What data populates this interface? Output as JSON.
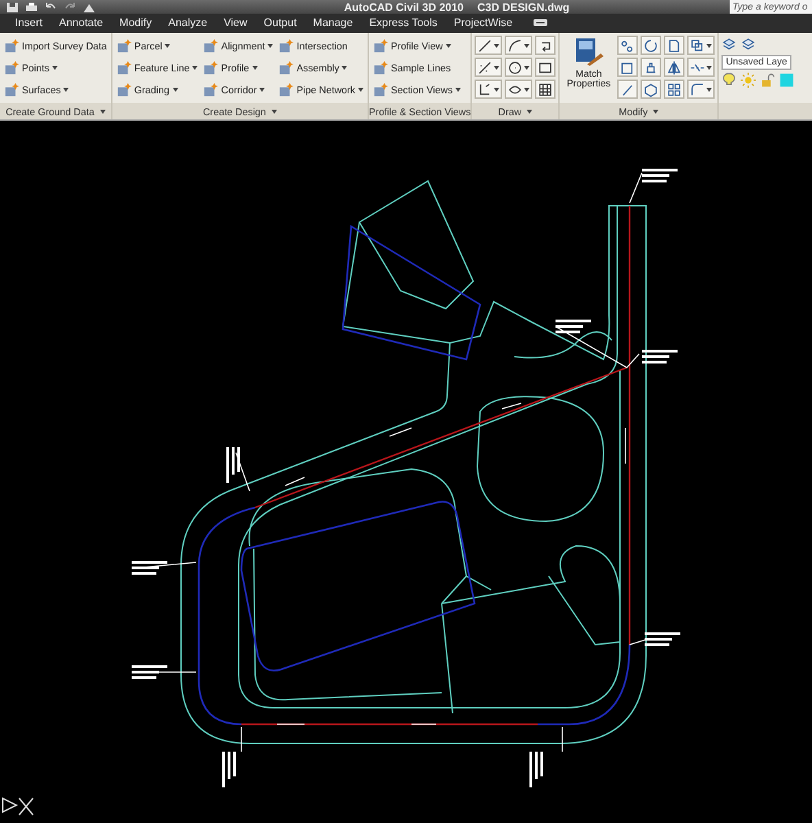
{
  "window": {
    "title": "AutoCAD Civil 3D 2010",
    "document": "C3D DESIGN.dwg",
    "search": {
      "placeholder": "Type a keyword o"
    }
  },
  "menu": [
    "Insert",
    "Annotate",
    "Modify",
    "Analyze",
    "View",
    "Output",
    "Manage",
    "Express Tools",
    "ProjectWise"
  ],
  "ribbon": [
    {
      "kind": "tools",
      "title": "Create Ground Data",
      "dropdown": true,
      "columns": [
        [
          {
            "label": "Import Survey Data",
            "dropdown": false
          },
          {
            "label": "Points",
            "dropdown": true
          },
          {
            "label": "Surfaces",
            "dropdown": true
          }
        ]
      ]
    },
    {
      "kind": "tools",
      "title": "Create Design",
      "dropdown": true,
      "columns": [
        [
          {
            "label": "Parcel",
            "dropdown": true
          },
          {
            "label": "Feature Line",
            "dropdown": true
          },
          {
            "label": "Grading",
            "dropdown": true
          }
        ],
        [
          {
            "label": "Alignment",
            "dropdown": true
          },
          {
            "label": "Profile",
            "dropdown": true
          },
          {
            "label": "Corridor",
            "dropdown": true
          }
        ],
        [
          {
            "label": "Intersection",
            "dropdown": false
          },
          {
            "label": "Assembly",
            "dropdown": true
          },
          {
            "label": "Pipe Network",
            "dropdown": true
          }
        ]
      ]
    },
    {
      "kind": "tools",
      "title": "Profile & Section Views",
      "dropdown": false,
      "columns": [
        [
          {
            "label": "Profile View",
            "dropdown": true
          },
          {
            "label": "Sample Lines",
            "dropdown": false
          },
          {
            "label": "Section Views",
            "dropdown": true
          }
        ]
      ]
    },
    {
      "kind": "icons",
      "title": "Draw",
      "dropdown": true,
      "buttons": [
        {
          "dropdown": true
        },
        {
          "dropdown": true
        },
        {
          "dropdown": false
        },
        {
          "dropdown": true
        },
        {
          "dropdown": true
        },
        {
          "dropdown": false
        },
        {
          "dropdown": true
        },
        {
          "dropdown": true
        },
        {
          "dropdown": false
        }
      ]
    },
    {
      "kind": "modify",
      "title": "Modify",
      "dropdown": true,
      "large": "Match Properties",
      "buttons": [
        {
          "dropdown": false
        },
        {
          "dropdown": false
        },
        {
          "dropdown": false
        },
        {
          "dropdown": true
        },
        {
          "dropdown": false
        },
        {
          "dropdown": false
        },
        {
          "dropdown": false
        },
        {
          "dropdown": true
        },
        {
          "dropdown": false
        },
        {
          "dropdown": false
        },
        {
          "dropdown": false
        },
        {
          "dropdown": true
        }
      ]
    },
    {
      "kind": "layers",
      "layer": "Unsaved Laye"
    }
  ]
}
